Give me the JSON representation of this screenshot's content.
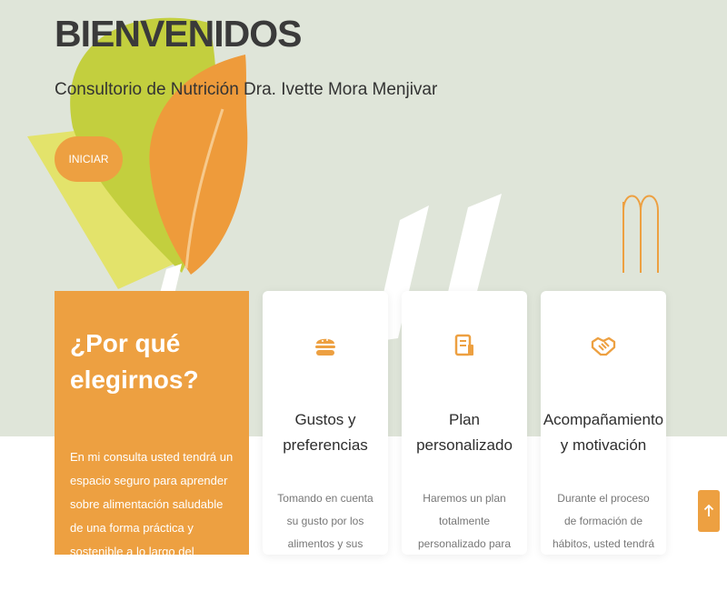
{
  "hero": {
    "title": "BIENVENIDOS",
    "subtitle": "Consultorio de Nutrición Dra. Ivette Mora Menjivar",
    "cta_label": "INICIAR",
    "bg_color": "#dfe5d9",
    "leaf_colors": [
      "#e4e36a",
      "#c3cf3e",
      "#ee9b3b"
    ],
    "logo_icon": "m-monogram-icon"
  },
  "why": {
    "title": "¿Por qué elegirnos?",
    "text": "En mi consulta usted tendrá un espacio seguro para aprender sobre alimentación saludable de una forma práctica y sostenible a lo largo del tiempo. Mi objetivo es acompañarle",
    "bg_color": "#eda041"
  },
  "features": [
    {
      "icon": "burger-icon",
      "title": "Gustos y preferencias",
      "text": "Tomando en cuenta su gusto por los alimentos y sus preferencias"
    },
    {
      "icon": "plan-document-icon",
      "title": "Plan personalizado",
      "text": "Haremos un plan totalmente personalizado para"
    },
    {
      "icon": "handshake-icon",
      "title": "Acompañamiento y motivación",
      "text": "Durante el proceso de formación de hábitos, usted tendrá"
    }
  ],
  "scroll_top": {
    "icon": "arrow-up-icon"
  },
  "accent_color": "#eda041"
}
